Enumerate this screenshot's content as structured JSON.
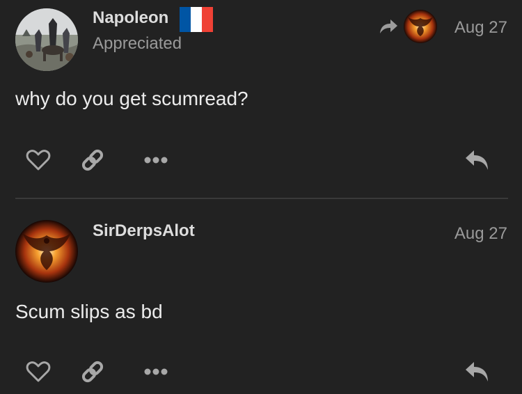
{
  "posts": [
    {
      "username": "Napoleon",
      "user_title": "Appreciated",
      "flag": "france-flag-icon",
      "avatar": "napoleon-painting-avatar",
      "reply_to_avatar": "phoenix-avatar",
      "date": "Aug 27",
      "body": "why do you get scumread?"
    },
    {
      "username": "SirDerpsAlot",
      "avatar": "phoenix-avatar",
      "date": "Aug 27",
      "body": "Scum slips as bd"
    }
  ],
  "actions": {
    "like_icon": "heart-icon",
    "link_icon": "link-icon",
    "more_icon": "ellipsis-icon",
    "reply_icon": "reply-icon"
  },
  "colors": {
    "background": "#222222",
    "text": "#e6e6e6",
    "muted": "#9a9a9a",
    "icon": "#a8a8a8",
    "flag_blue": "#0055a4",
    "flag_red": "#ef4135"
  }
}
